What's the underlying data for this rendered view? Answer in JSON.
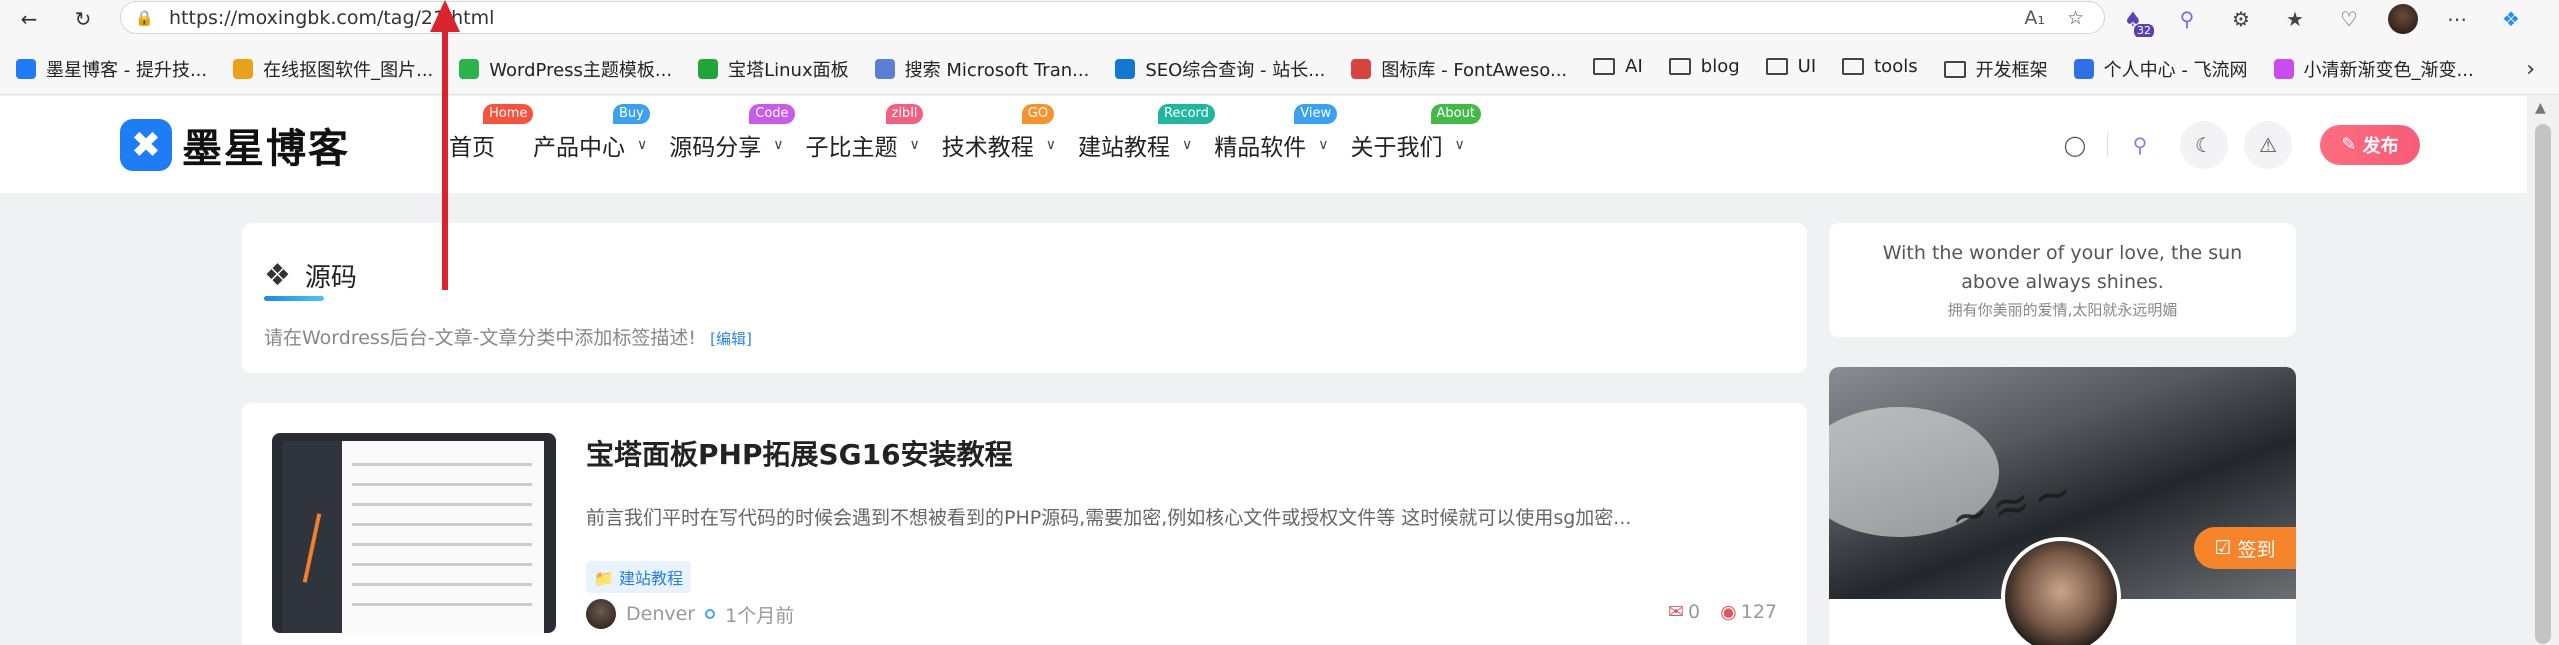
{
  "browser": {
    "url": "https://moxingbk.com/tag/21.html",
    "extension_badge": "32"
  },
  "bookmarks": [
    {
      "label": "墨星博客 - 提升技...",
      "icon": "blog-favicon",
      "color": "#1e7cf5"
    },
    {
      "label": "在线抠图软件_图片...",
      "icon": "cutout-favicon",
      "color": "#e8a21a"
    },
    {
      "label": "WordPress主题模板...",
      "icon": "wordpress-favicon",
      "color": "#2bb24c"
    },
    {
      "label": "宝塔Linux面板",
      "icon": "bt-favicon",
      "color": "#20a53a"
    },
    {
      "label": "搜索 Microsoft Tran...",
      "icon": "translator-favicon",
      "color": "#5c7fd6"
    },
    {
      "label": "SEO综合查询 - 站长...",
      "icon": "seo-favicon",
      "color": "#1677d2"
    },
    {
      "label": "图标库 - FontAweso...",
      "icon": "iconlib-favicon",
      "color": "#d6453d"
    },
    {
      "label": "AI",
      "icon": "folder-icon",
      "folder": true
    },
    {
      "label": "blog",
      "icon": "folder-icon",
      "folder": true
    },
    {
      "label": "UI",
      "icon": "folder-icon",
      "folder": true
    },
    {
      "label": "tools",
      "icon": "folder-icon",
      "folder": true
    },
    {
      "label": "开发框架",
      "icon": "folder-icon",
      "folder": true
    },
    {
      "label": "个人中心 - 飞流网",
      "icon": "feiliu-favicon",
      "color": "#2f6fe8"
    },
    {
      "label": "小清新渐变色_渐变...",
      "icon": "gradient-favicon",
      "color": "#c84cf0"
    }
  ],
  "site": {
    "logo_text": "墨星博客",
    "nav": [
      {
        "label": "首页",
        "tag": "Home",
        "tag_color": "#f5533d",
        "dropdown": false
      },
      {
        "label": "产品中心",
        "tag": "Buy",
        "tag_color": "#3aa0f0",
        "dropdown": true
      },
      {
        "label": "源码分享",
        "tag": "Code",
        "tag_color": "#c75ce8",
        "dropdown": true
      },
      {
        "label": "子比主题",
        "tag": "zibll",
        "tag_color": "#f06080",
        "dropdown": true
      },
      {
        "label": "技术教程",
        "tag": "GO",
        "tag_color": "#f5932e",
        "dropdown": true
      },
      {
        "label": "建站教程",
        "tag": "Record",
        "tag_color": "#22b5a0",
        "dropdown": true
      },
      {
        "label": "精品软件",
        "tag": "View",
        "tag_color": "#3aa0f0",
        "dropdown": true
      },
      {
        "label": "关于我们",
        "tag": "About",
        "tag_color": "#45b84a",
        "dropdown": true
      }
    ],
    "publish_label": "发布"
  },
  "tag_page": {
    "title": "源码",
    "description": "请在Wordress后台-文章-文章分类中添加标签描述!",
    "edit_label": "[编辑]"
  },
  "posts": [
    {
      "title": "宝塔面板PHP拓展SG16安装教程",
      "excerpt": "前言我们平时在写代码的时候会遇到不想被看到的PHP源码,需要加密,例如核心文件或授权文件等 这时候就可以使用sg加密...",
      "category": "建站教程",
      "author": "Denver",
      "time": "1个月前",
      "comments": "0",
      "views": "127"
    }
  ],
  "sidebar": {
    "quote_en": "With the wonder of your love, the sun above always shines.",
    "quote_cn": "拥有你美丽的爱情,太阳就永远明媚",
    "signin_label": "签到"
  }
}
